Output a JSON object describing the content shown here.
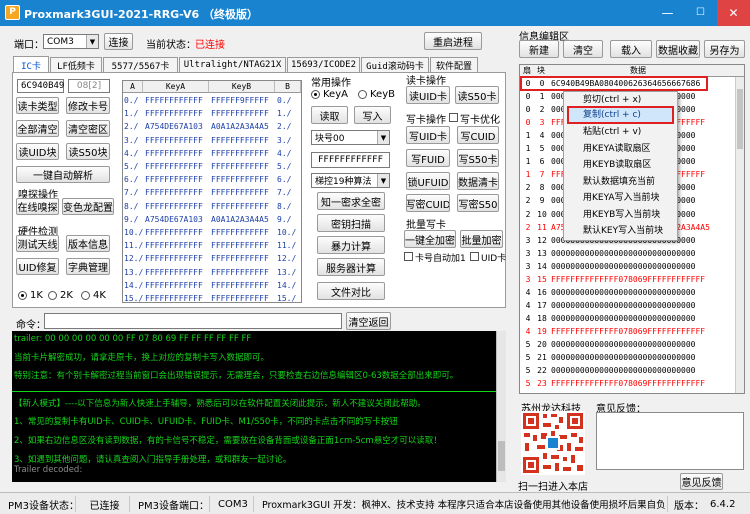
{
  "window": {
    "title": "Proxmark3GUI-2021-RRG-V6 （终极版）",
    "logo": "P",
    "min": "—",
    "max": "☐",
    "close": "✕"
  },
  "toolbar": {
    "port_label": "端口：",
    "port_value": "COM3",
    "connect_btn": "连接",
    "state_label": "当前状态：",
    "state_value": "已连接",
    "restart_btn": "重启进程"
  },
  "colors": {
    "accent": "#1a83cf",
    "state_red": "#ff0000",
    "console_green": "#15d51a"
  },
  "tabs": [
    "IC卡",
    "LF低频卡",
    "5577/5567卡",
    "Ultralight/NTAG21X",
    "15693/ICODE2",
    "Guid滚动码卡",
    "软件配置"
  ],
  "ic": {
    "uid_value": "6C940B49",
    "size_value": "08[2]",
    "btn_read_type": "读卡类型",
    "btn_mod_num": "修改卡号",
    "btn_all_clear": "全部清空",
    "btn_clear_secret": "清空密区",
    "btn_read_uid": "读UID块",
    "btn_read_s50": "读S50块",
    "btn_crack": "一键自动解析",
    "sniff_title": "嗅探操作",
    "btn_online_sniff": "在线嗅探",
    "btn_chameleon": "变色龙配置",
    "hw_title": "硬件检测",
    "btn_test_antenna": "测试天线",
    "btn_version": "版本信息",
    "btn_uid_fix": "UID修复",
    "btn_dict": "字典管理",
    "radio_1k": "1K",
    "radio_2k": "2K",
    "radio_4k": "4K"
  },
  "keys": {
    "headers": [
      "A",
      "KeyA",
      "KeyB",
      "B"
    ],
    "rows": [
      {
        "a": "0./",
        "ka": "FFFFFFFFFFFF",
        "kb": "FFFFFF9FFFFF",
        "b": "0./"
      },
      {
        "a": "1./",
        "ka": "FFFFFFFFFFFF",
        "kb": "FFFFFFFFFFFF",
        "b": "1./"
      },
      {
        "a": "2./",
        "ka": "A754DE67A103",
        "kb": "A0A1A2A3A4A5",
        "b": "2./"
      },
      {
        "a": "3./",
        "ka": "FFFFFFFFFFFF",
        "kb": "FFFFFFFFFFFF",
        "b": "3./"
      },
      {
        "a": "4./",
        "ka": "FFFFFFFFFFFF",
        "kb": "FFFFFFFFFFFF",
        "b": "4./"
      },
      {
        "a": "5./",
        "ka": "FFFFFFFFFFFF",
        "kb": "FFFFFFFFFFFF",
        "b": "5./"
      },
      {
        "a": "6./",
        "ka": "FFFFFFFFFFFF",
        "kb": "FFFFFFFFFFFF",
        "b": "6./"
      },
      {
        "a": "7./",
        "ka": "FFFFFFFFFFFF",
        "kb": "FFFFFFFFFFFF",
        "b": "7./"
      },
      {
        "a": "8./",
        "ka": "FFFFFFFFFFFF",
        "kb": "FFFFFFFFFFFF",
        "b": "8./"
      },
      {
        "a": "9./",
        "ka": "A754DE67A103",
        "kb": "A0A1A2A3A4A5",
        "b": "9./"
      },
      {
        "a": "10./",
        "ka": "FFFFFFFFFFFF",
        "kb": "FFFFFFFFFFFF",
        "b": "10./"
      },
      {
        "a": "11./",
        "ka": "FFFFFFFFFFFF",
        "kb": "FFFFFFFFFFFF",
        "b": "11./"
      },
      {
        "a": "12./",
        "ka": "FFFFFFFFFFFF",
        "kb": "FFFFFFFFFFFF",
        "b": "12./"
      },
      {
        "a": "13./",
        "ka": "FFFFFFFFFFFF",
        "kb": "FFFFFFFFFFFF",
        "b": "13./"
      },
      {
        "a": "14./",
        "ka": "FFFFFFFFFFFF",
        "kb": "FFFFFFFFFFFF",
        "b": "14./"
      },
      {
        "a": "15./",
        "ka": "FFFFFFFFFFFF",
        "kb": "FFFFFFFFFFFF",
        "b": "15./"
      }
    ]
  },
  "ops": {
    "title": "常用操作",
    "radio_keya": "KeyA",
    "radio_keyb": "KeyB",
    "btn_read": "读取",
    "btn_write": "写入",
    "block_select": "块号00",
    "key_input": "FFFFFFFFFFFF",
    "algo_select": "梯控19种算法",
    "btn_known_key": "知一密求全密",
    "btn_key_scan": "密钥扫描",
    "btn_brute": "暴力计算",
    "btn_server": "服务器计算",
    "btn_compare": "文件对比"
  },
  "readcard": {
    "title": "读卡操作",
    "btn_read_uid": "读UID卡",
    "btn_read_s50": "读S50卡"
  },
  "writecard": {
    "title": "写卡操作",
    "chk_optimize": "写卡优化",
    "btn_write_uid": "写UID卡",
    "btn_write_cuid": "写CUID",
    "btn_write_fuid": "写FUID",
    "btn_write_s50": "写S50卡",
    "btn_lock_ufuid": "锁UFUID",
    "btn_clean_card": "数据清卡",
    "btn_write_cuid_block": "写密CUID",
    "btn_write_s50_block": "写密S50"
  },
  "batch": {
    "title": "批量写卡",
    "btn_one_click": "一键全加密",
    "btn_batch_encrypt": "批量加密",
    "chk_auto_add": "卡号自动加1",
    "chk_uid_card": "UID卡"
  },
  "command": {
    "label": "命令：",
    "btn_back": "清空返回"
  },
  "console": {
    "lines": [
      "trailer: 00 00 00 00 00 00 FF 07 80 69 FF FF FF FF FF FF",
      "当前卡片解密成功，请拿走原卡，换上对应的复制卡写入数据即可。",
      "特别注意：有个别卡解密过程当前窗口会出现错误提示，无需理会，只要检查右边信息编辑区0-63数据全部出来即可。",
      "【新人模式】----以下信息为新人快速上手辅导，熟悉后可以在软件配置关闭此提示，新人不建议关闭此帮助。",
      "1、常见的复制卡有UID卡、CUID卡、UFUID卡、FUID卡、M1/S50卡，不同的卡点击不同的写卡按钮",
      "2、如果右边信息区没有读到数据，有的卡信号不稳定，需要放在设备背面或设备正面1cm-5cm悬空才可以读取！",
      "3、如遇到其他问题，请认真查阅入门指导手册处理，或和群友一起讨论。",
      "Trailer decoded:"
    ]
  },
  "editor": {
    "title": "信息编辑区",
    "btn_new": "新建",
    "btn_clear": "清空",
    "btn_load": "载入",
    "btn_collect": "数据收藏",
    "btn_save_as": "另存为",
    "headers": [
      "扇",
      "块",
      "数据"
    ],
    "rows": [
      {
        "s": "0",
        "b": "0",
        "d": "6C940B49BA080400626364656667686",
        "c": "#000000"
      },
      {
        "s": "0",
        "b": "1",
        "d": "000000000000000000000000000000",
        "c": "#000000"
      },
      {
        "s": "0",
        "b": "2",
        "d": "000000000000000000000000000000",
        "c": "#000000"
      },
      {
        "s": "0",
        "b": "3",
        "d": "FFFFFFFFFFFFFF078069FFFFFFFFFFFF",
        "c": "#ff0000"
      },
      {
        "s": "1",
        "b": "4",
        "d": "000000000000000000000000000000",
        "c": "#000000"
      },
      {
        "s": "1",
        "b": "5",
        "d": "000000000000000000000000000000",
        "c": "#000000"
      },
      {
        "s": "1",
        "b": "6",
        "d": "000000000000000000000000000000",
        "c": "#000000"
      },
      {
        "s": "1",
        "b": "7",
        "d": "FFFFFFFFFFFFFF078069FFFFFFFFFFFF",
        "c": "#ff0000"
      },
      {
        "s": "2",
        "b": "8",
        "d": "000000000000000000000000000000",
        "c": "#000000"
      },
      {
        "s": "2",
        "b": "9",
        "d": "000000000000000000000000000000",
        "c": "#000000"
      },
      {
        "s": "2",
        "b": "10",
        "d": "000000000000000000000000000000",
        "c": "#000000"
      },
      {
        "s": "2",
        "b": "11",
        "d": "A754DE67A103FF0780690A0A1A2A3A4A5",
        "c": "#ff0000"
      },
      {
        "s": "3",
        "b": "12",
        "d": "000000000000000000000000000000",
        "c": "#000000"
      },
      {
        "s": "3",
        "b": "13",
        "d": "000000000000000000000000000000",
        "c": "#000000"
      },
      {
        "s": "3",
        "b": "14",
        "d": "000000000000000000000000000000",
        "c": "#000000"
      },
      {
        "s": "3",
        "b": "15",
        "d": "FFFFFFFFFFFFFF078069FFFFFFFFFFFF",
        "c": "#ff0000"
      },
      {
        "s": "4",
        "b": "16",
        "d": "000000000000000000000000000000",
        "c": "#000000"
      },
      {
        "s": "4",
        "b": "17",
        "d": "000000000000000000000000000000",
        "c": "#000000"
      },
      {
        "s": "4",
        "b": "18",
        "d": "000000000000000000000000000000",
        "c": "#000000"
      },
      {
        "s": "4",
        "b": "19",
        "d": "FFFFFFFFFFFFFF078069FFFFFFFFFFFF",
        "c": "#ff0000"
      },
      {
        "s": "5",
        "b": "20",
        "d": "000000000000000000000000000000",
        "c": "#000000"
      },
      {
        "s": "5",
        "b": "21",
        "d": "000000000000000000000000000000",
        "c": "#000000"
      },
      {
        "s": "5",
        "b": "22",
        "d": "000000000000000000000000000000",
        "c": "#000000"
      },
      {
        "s": "5",
        "b": "23",
        "d": "FFFFFFFFFFFFFF078069FFFFFFFFFFFF",
        "c": "#ff0000"
      }
    ]
  },
  "context_menu": {
    "items": [
      "剪切(ctrl + x)",
      "复制(ctrl + c)",
      "粘贴(ctrl + v)",
      "用KEYA读取扇区",
      "用KEYB读取扇区",
      "默认数据填充当前",
      "用KEYA写入当前块",
      "用KEYB写入当前块",
      "默认KEY写入当前块"
    ],
    "selected_index": 1
  },
  "company": {
    "name": "苏州龙达科技",
    "qr_caption": "扫一扫进入本店"
  },
  "feedback": {
    "title": "意见反馈：",
    "btn": "意见反馈"
  },
  "statusbar": {
    "pm3_label": "PM3设备状态：",
    "pm3_value": "已连接",
    "port_label": "PM3设备端口：",
    "port_value": "COM3",
    "dev_info": "Proxmark3GUI 开发：枫神X、技术支持  本程序只适合本店设备使用其他设备使用损坏后果自负!",
    "version_label": "版本：",
    "version_value": "6.4.2"
  }
}
